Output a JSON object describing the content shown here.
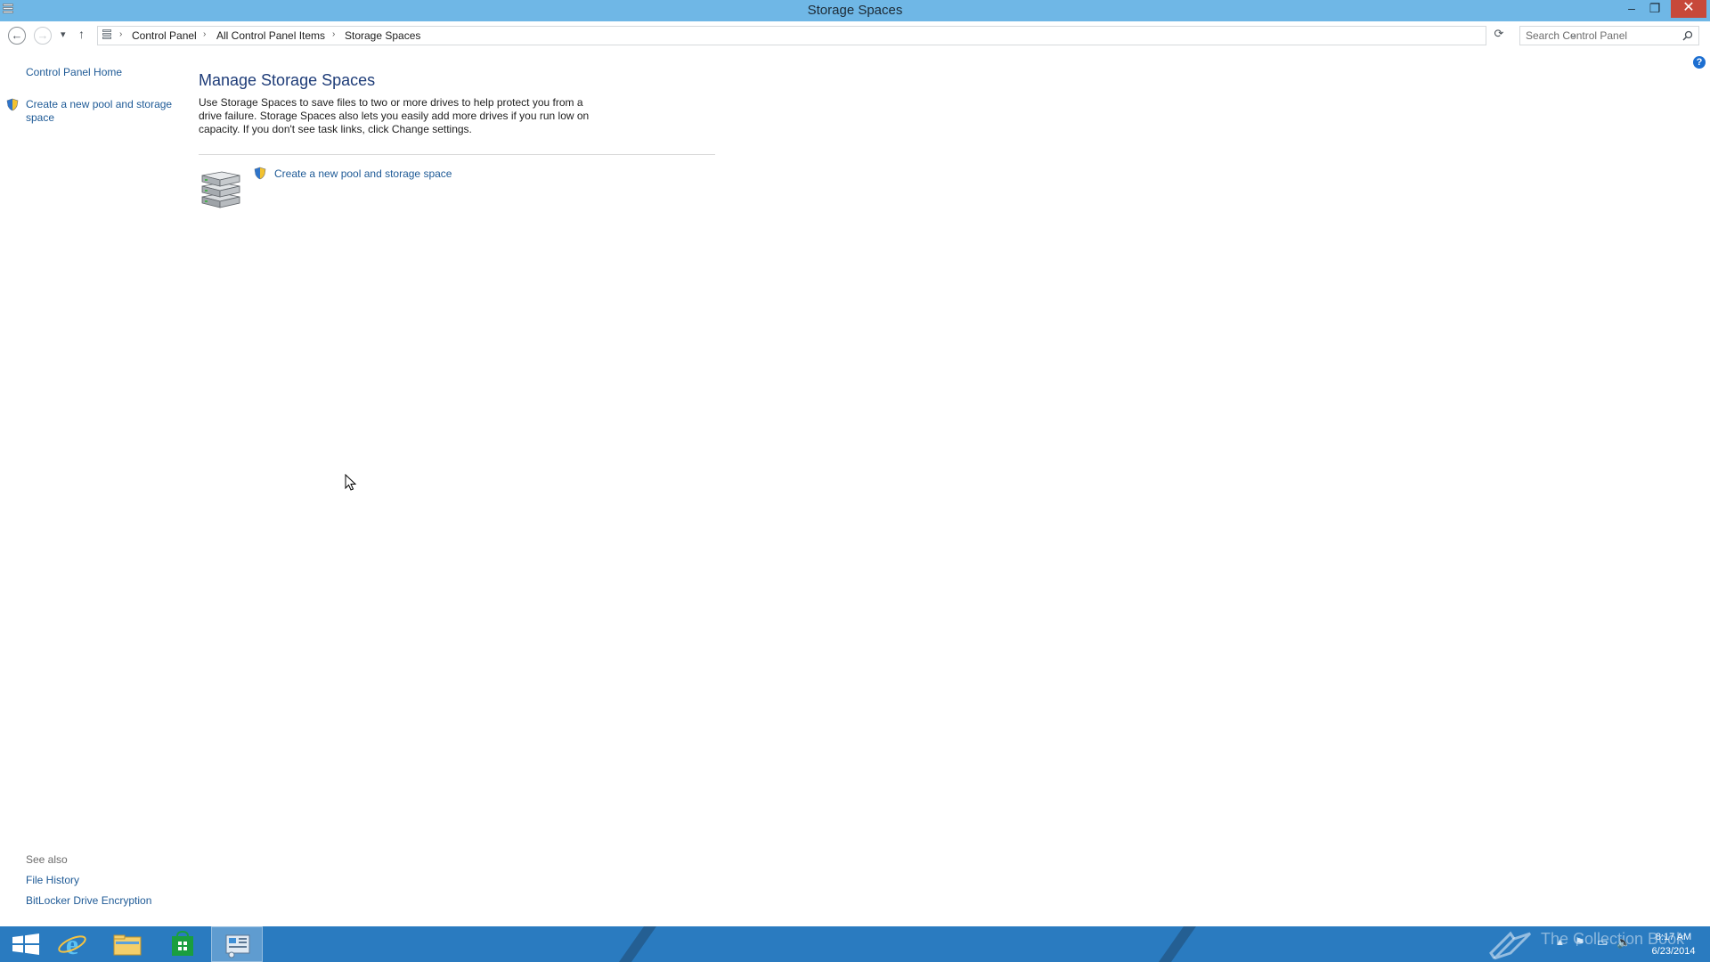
{
  "window": {
    "title": "Storage Spaces",
    "controls": {
      "minimize": "–",
      "restore": "❐",
      "close": "✕"
    }
  },
  "address_bar": {
    "breadcrumbs": [
      "Control Panel",
      "All Control Panel Items",
      "Storage Spaces"
    ],
    "search_placeholder": "Search Control Panel"
  },
  "left_pane": {
    "home_link": "Control Panel Home",
    "task_link": "Create a new pool and storage space",
    "see_also_heading": "See also",
    "see_also_links": [
      "File History",
      "BitLocker Drive Encryption"
    ]
  },
  "main": {
    "heading": "Manage Storage Spaces",
    "description": "Use Storage Spaces to save files to two or more drives to help protect you from a drive failure. Storage Spaces also lets you easily add more drives if you run low on capacity. If you don't see task links, click Change settings.",
    "task_link": "Create a new pool and storage space"
  },
  "taskbar": {
    "pinned": [
      "start-button",
      "internet-explorer",
      "file-explorer",
      "store",
      "control-panel"
    ],
    "active_item": "control-panel",
    "watermark": "The Collection Book",
    "clock_time": "8:17 AM",
    "clock_date": "6/23/2014"
  },
  "colors": {
    "titlebar": "#6fb7e6",
    "link": "#1e5a96",
    "heading": "#1e3c78",
    "taskbar": "#2a7bc0",
    "close_button": "#c7493a"
  }
}
